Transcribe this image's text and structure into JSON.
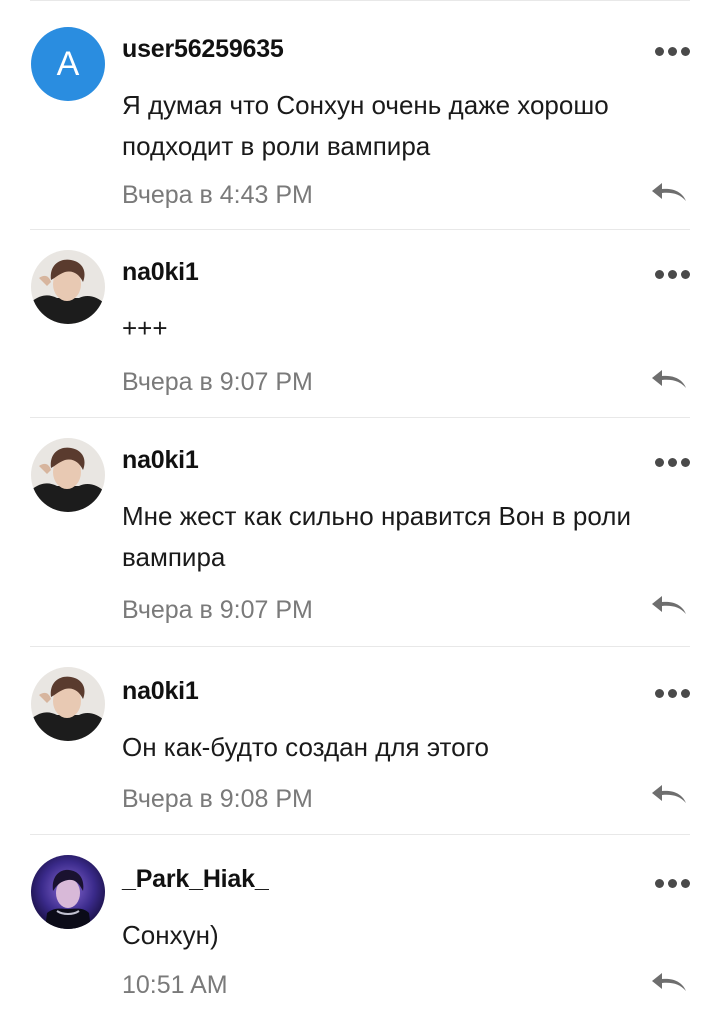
{
  "comments": [
    {
      "avatar_letter": "A",
      "username": "user56259635",
      "text": "Я думая что Сонхун очень даже хорошо подходит в роли вампира",
      "time": "Вчера в 4:43 PM"
    },
    {
      "username": "na0ki1",
      "text": "+++",
      "time": "Вчера в 9:07 PM"
    },
    {
      "username": "na0ki1",
      "text": "Мне жест как сильно нравится Вон в роли вампира",
      "time": "Вчера в 9:07 PM"
    },
    {
      "username": "na0ki1",
      "text": "Он как-будто создан для этого",
      "time": "Вчера в 9:08 PM"
    },
    {
      "username": "_Park_Hiak_",
      "text": "Сонхун)",
      "time": "10:51 AM"
    }
  ],
  "icons": {
    "more": "more-dots-icon",
    "reply": "reply-arrow-icon"
  },
  "colors": {
    "avatar_letter_bg": "#2a8de0",
    "time_text": "#7a7a7a",
    "divider": "#e8e8e8"
  }
}
